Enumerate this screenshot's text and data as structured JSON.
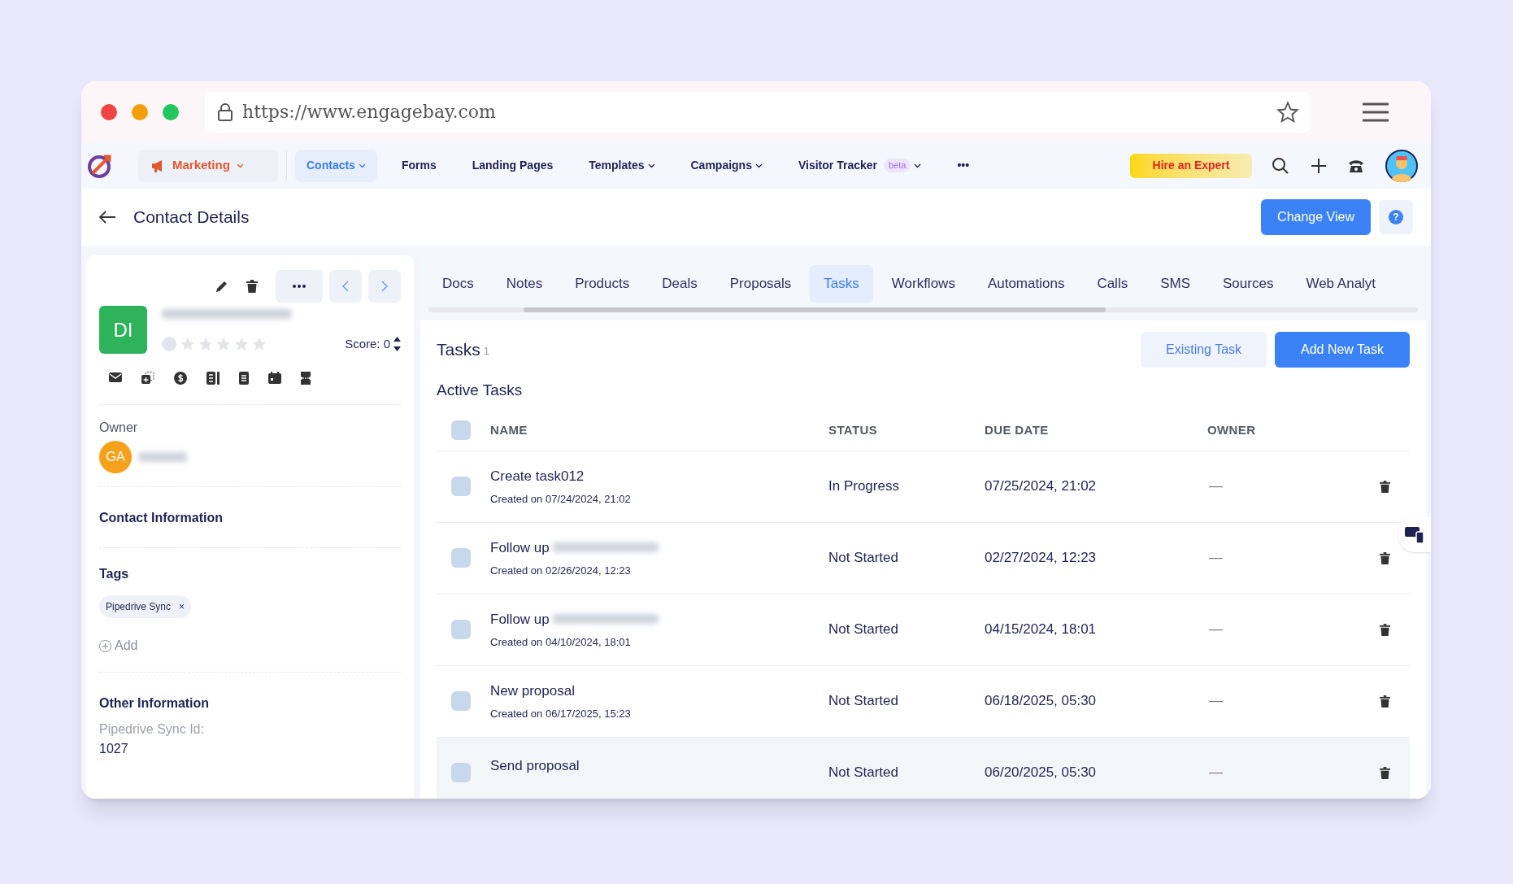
{
  "browser": {
    "url": "https://www.engagebay.com"
  },
  "nav": {
    "module": "Marketing",
    "items": [
      {
        "label": "Contacts",
        "selected": true,
        "dropdown": true
      },
      {
        "label": "Forms",
        "selected": false,
        "dropdown": false
      },
      {
        "label": "Landing Pages",
        "selected": false,
        "dropdown": false
      },
      {
        "label": "Templates",
        "selected": false,
        "dropdown": true
      },
      {
        "label": "Campaigns",
        "selected": false,
        "dropdown": true
      },
      {
        "label": "Visitor Tracker",
        "selected": false,
        "dropdown": true,
        "badge": "beta"
      }
    ],
    "more": "•••",
    "cta": "Hire an Expert"
  },
  "header": {
    "title": "Contact Details",
    "button": "Change View",
    "help": "?"
  },
  "contact": {
    "initials": "DI",
    "stars": 0,
    "score": "Score: 0",
    "owner_label": "Owner",
    "owner_initials": "GA",
    "sections": [
      "Contact Information"
    ],
    "tags_title": "Tags",
    "tags": [
      "Pipedrive Sync"
    ],
    "tag_remove": "×",
    "add": "Add",
    "other_title": "Other Information",
    "fields": [
      {
        "label": "Pipedrive Sync Id:",
        "value": "1027"
      }
    ]
  },
  "tabs": [
    {
      "label": "Docs",
      "selected": false
    },
    {
      "label": "Notes",
      "selected": false
    },
    {
      "label": "Products",
      "selected": false
    },
    {
      "label": "Deals",
      "selected": false
    },
    {
      "label": "Proposals",
      "selected": false
    },
    {
      "label": "Tasks",
      "selected": true
    },
    {
      "label": "Workflows",
      "selected": false
    },
    {
      "label": "Automations",
      "selected": false
    },
    {
      "label": "Calls",
      "selected": false
    },
    {
      "label": "SMS",
      "selected": false
    },
    {
      "label": "Sources",
      "selected": false
    },
    {
      "label": "Web Analyt",
      "selected": false
    }
  ],
  "tasks": {
    "title": "Tasks",
    "count": "1",
    "existing": "Existing Task",
    "add": "Add New Task",
    "section": "Active Tasks",
    "select_all_checked": false,
    "columns": [
      "NAME",
      "STATUS",
      "DUE DATE",
      "OWNER"
    ],
    "rows": [
      {
        "name": "Create task012",
        "redacted": false,
        "created": "Created on 07/24/2024, 21:02",
        "status": "In Progress",
        "due": "07/25/2024, 21:02",
        "owner": "—",
        "checked": false,
        "highlighted": false
      },
      {
        "name": "Follow up",
        "redacted": true,
        "created": "Created on 02/26/2024, 12:23",
        "status": "Not Started",
        "due": "02/27/2024, 12:23",
        "owner": "—",
        "checked": false,
        "highlighted": false
      },
      {
        "name": "Follow up",
        "redacted": true,
        "created": "Created on 04/10/2024, 18:01",
        "status": "Not Started",
        "due": "04/15/2024, 18:01",
        "owner": "—",
        "checked": false,
        "highlighted": false
      },
      {
        "name": "New proposal",
        "redacted": false,
        "created": "Created on 06/17/2025, 15:23",
        "status": "Not Started",
        "due": "06/18/2025, 05:30",
        "owner": "—",
        "checked": false,
        "highlighted": false
      },
      {
        "name": "Send proposal",
        "redacted": false,
        "status": "Not Started",
        "due": "06/20/2025, 05:30",
        "owner": "—",
        "checked": false,
        "highlighted": true
      }
    ]
  }
}
